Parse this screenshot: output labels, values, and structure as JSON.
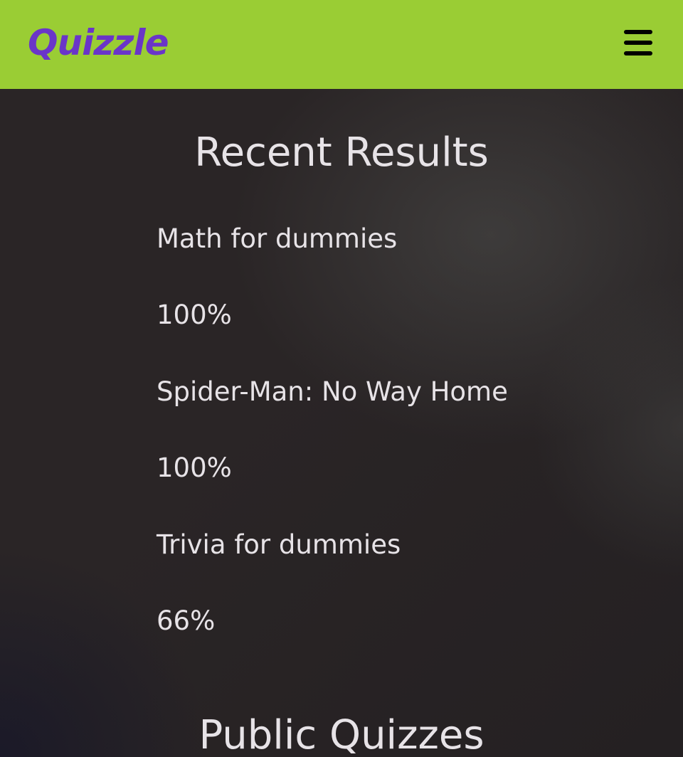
{
  "header": {
    "logo": "Quizzle",
    "brand_color": "#6a35c8",
    "background_color": "#9acd34",
    "menu_icon": "hamburger-menu-icon"
  },
  "recent_results": {
    "title": "Recent Results",
    "items": [
      {
        "name": "Math for dummies",
        "score": "100%"
      },
      {
        "name": "Spider-Man: No Way Home",
        "score": "100%"
      },
      {
        "name": "Trivia for dummies",
        "score": "66%"
      }
    ]
  },
  "public_quizzes": {
    "title": "Public Quizzes"
  }
}
